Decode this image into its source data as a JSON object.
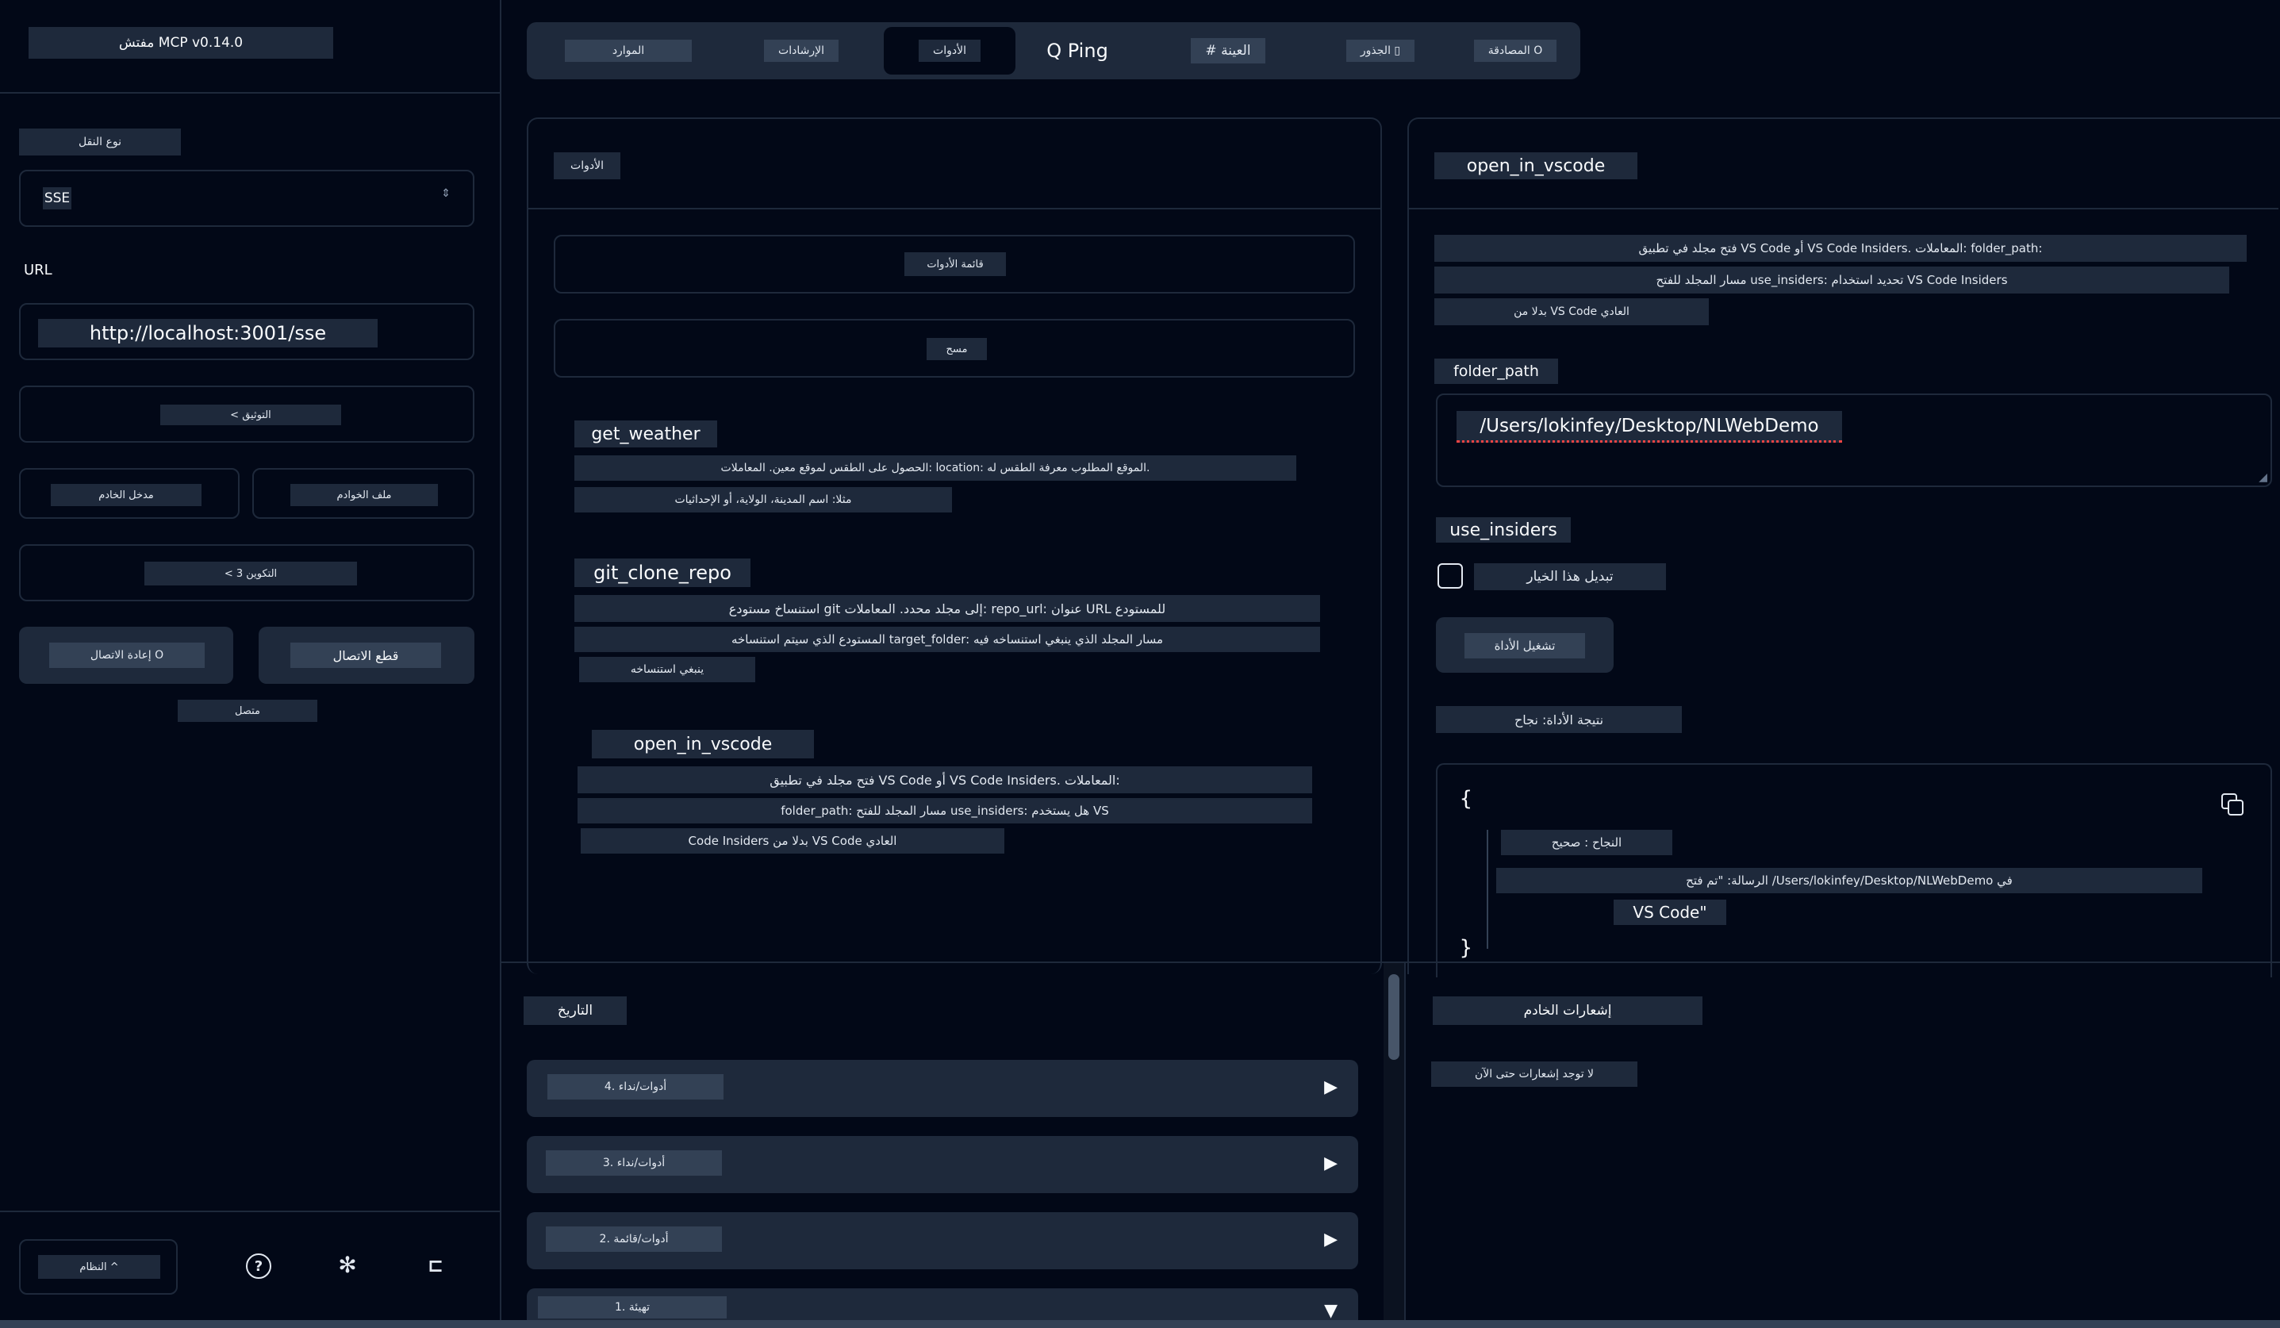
{
  "sidebar": {
    "title": "مفتش MCP v0.14.0",
    "transport_label": "نوع النقل",
    "transport_value": "SSE",
    "url_label": "URL",
    "url_value": "http://localhost:3001/sse",
    "auth_button": "< التوثيق",
    "server_entry": "مدخل الخادم",
    "servers_file": "ملف الخوادم",
    "config_button": "< 3 التكوين",
    "reconnect_button": "إعادة الاتصال O",
    "disconnect_button": "قطع الاتصال",
    "status": "متصل",
    "theme_button": "النظام ^"
  },
  "tabs": [
    {
      "label": "المصادقة O",
      "active": false
    },
    {
      "label": "الجذور ▯",
      "active": false
    },
    {
      "label": "# العينة",
      "active": false
    },
    {
      "label": "Q Ping",
      "active": false
    },
    {
      "label": "الأدوات",
      "active": true
    },
    {
      "label": "الإرشادات",
      "active": false
    },
    {
      "label": "الموارد",
      "active": false
    }
  ],
  "tools_panel": {
    "title": "الأدوات",
    "list_button": "قائمة الأدوات",
    "clear_button": "مسح",
    "tools": [
      {
        "name": "get_weather",
        "desc1": "الحصول على الطقس لموقع معين. المعاملات: location: الموقع المطلوب معرفة الطقس له.",
        "desc2": "مثلا: اسم المدينة، الولاية، أو الإحداثيات"
      },
      {
        "name": "git_clone_repo",
        "desc1": "استنساخ مستودع git إلى مجلد محدد. المعاملات: repo_url: عنوان URL للمستودع",
        "desc2": "المستودع الذي سيتم استنساخه target_folder: مسار المجلد الذي ينبغي استنساخه فيه",
        "desc3": "ينبغي استنساخه"
      },
      {
        "name": "open_in_vscode",
        "desc1": "فتح مجلد في تطبيق VS Code أو VS Code Insiders. المعاملات:",
        "desc2": "folder_path: مسار المجلد للفتح use_insiders: هل يستخدم VS",
        "desc3": "Code Insiders بدلا من VS Code العادي"
      }
    ]
  },
  "detail_panel": {
    "title": "open_in_vscode",
    "desc1": "فتح مجلد في تطبيق VS Code أو VS Code Insiders. المعاملات: folder_path:",
    "desc2": "مسار المجلد للفتح use_insiders: تحديد استخدام VS Code Insiders",
    "desc3": "بدلا من VS Code العادي",
    "folder_label": "folder_path",
    "folder_value": "/Users/lokinfey/Desktop/NLWebDemo",
    "insiders_label": "use_insiders",
    "toggle_label": "تبديل هذا الخيار",
    "run_button": "تشغيل الأداة",
    "result_label": "نتيجة الأداة: نجاح",
    "json_open": "{",
    "json_success": "النجاح : صحيح",
    "json_message": "الرسالة: \"تم فتح /Users/lokinfey/Desktop/NLWebDemo في",
    "json_message2": "VS Code\"",
    "json_close": "}"
  },
  "history": {
    "title": "التاريخ",
    "items": [
      {
        "label": "4. أدوات/نداء",
        "arrow": "▶"
      },
      {
        "label": "3. أدوات/نداء",
        "arrow": "▶"
      },
      {
        "label": "2. أدوات/قائمة",
        "arrow": "▶"
      },
      {
        "label": "1. تهيئة",
        "arrow": "▼"
      }
    ]
  },
  "notifications": {
    "title": "إشعارات الخادم",
    "empty": "لا توجد إشعارات حتى الآن"
  },
  "colors": {
    "background": "#020817",
    "surface": "#1e293b",
    "chip": "#334155",
    "error_underline": "#ef4444"
  }
}
